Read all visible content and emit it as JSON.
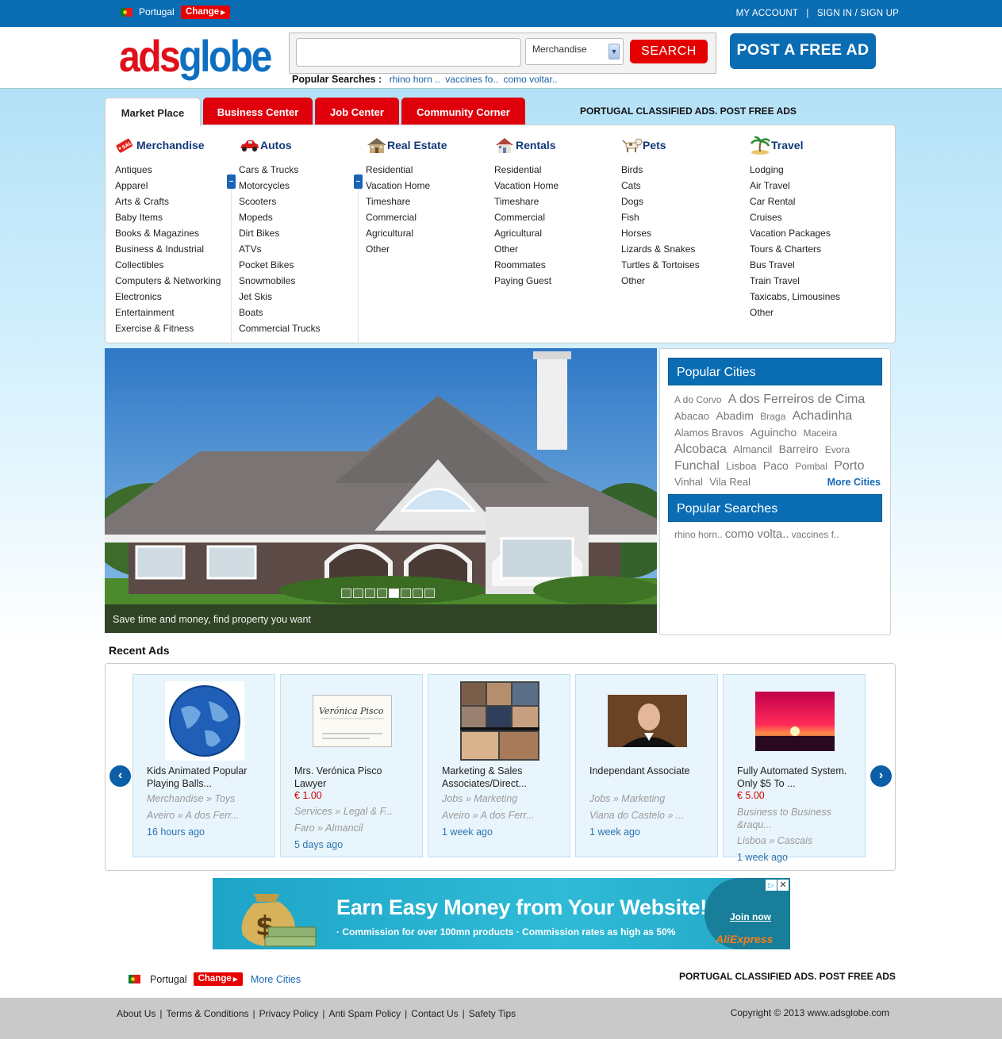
{
  "topbar": {
    "country": "Portugal",
    "change_label": "Change",
    "my_account": "MY ACCOUNT",
    "signin": "SIGN IN / SIGN UP"
  },
  "header": {
    "logo_part1": "ads",
    "logo_part2": "globe",
    "search_placeholder": "",
    "category_selected": "Merchandise",
    "search_button": "SEARCH",
    "popular_label": "Popular Searches :",
    "popular_items": [
      "rhino horn ..",
      "vaccines fo..",
      "como voltar.."
    ],
    "post_ad": "POST A FREE AD"
  },
  "tabs": [
    "Market Place",
    "Business Center",
    "Job Center",
    "Community Corner"
  ],
  "tagline": "PORTUGAL CLASSIFIED ADS. POST FREE ADS",
  "categories": [
    {
      "name": "Merchandise",
      "icon": "sale-tag-icon",
      "items": [
        "Antiques",
        "Apparel",
        "Arts & Crafts",
        "Baby Items",
        "Books & Magazines",
        "Business & Industrial",
        "Collectibles",
        "Computers & Networking",
        "Electronics",
        "Entertainment",
        "Exercise & Fitness"
      ]
    },
    {
      "name": "Autos",
      "icon": "car-icon",
      "items": [
        "Cars & Trucks",
        "Motorcycles",
        "Scooters",
        "Mopeds",
        "Dirt Bikes",
        "ATVs",
        "Pocket Bikes",
        "Snowmobiles",
        "Jet Skis",
        "Boats",
        "Commercial Trucks"
      ]
    },
    {
      "name": "Real Estate",
      "icon": "house-icon",
      "items": [
        "Residential",
        "Vacation Home",
        "Timeshare",
        "Commercial",
        "Agricultural",
        "Other"
      ]
    },
    {
      "name": "Rentals",
      "icon": "rental-house-icon",
      "items": [
        "Residential",
        "Vacation Home",
        "Timeshare",
        "Commercial",
        "Agricultural",
        "Other",
        "Roommates",
        "Paying Guest"
      ]
    },
    {
      "name": "Pets",
      "icon": "dog-icon",
      "items": [
        "Birds",
        "Cats",
        "Dogs",
        "Fish",
        "Horses",
        "Lizards & Snakes",
        "Turtles & Tortoises",
        "Other"
      ]
    },
    {
      "name": "Travel",
      "icon": "palm-island-icon",
      "items": [
        "Lodging",
        "Air Travel",
        "Car Rental",
        "Cruises",
        "Vacation Packages",
        "Tours & Charters",
        "Bus Travel",
        "Train Travel",
        "Taxicabs, Limousines",
        "Other"
      ]
    }
  ],
  "hero": {
    "caption": "Save time and money, find property you want",
    "slide_count": 8,
    "active_slide": 5
  },
  "sidebar": {
    "cities_title": "Popular Cities",
    "cities": [
      {
        "name": "A do Corvo",
        "size": 12
      },
      {
        "name": "A dos Ferreiros de Cima",
        "size": 16
      },
      {
        "name": "Abacao",
        "size": 13
      },
      {
        "name": "Abadim",
        "size": 14
      },
      {
        "name": "Braga",
        "size": 12
      },
      {
        "name": "Achadinha",
        "size": 16
      },
      {
        "name": "Alamos Bravos",
        "size": 13
      },
      {
        "name": "Aguincho",
        "size": 14
      },
      {
        "name": "Maceira",
        "size": 12
      },
      {
        "name": "Alcobaca",
        "size": 16
      },
      {
        "name": "Almancil",
        "size": 13
      },
      {
        "name": "Barreiro",
        "size": 14
      },
      {
        "name": "Evora",
        "size": 12
      },
      {
        "name": "Funchal",
        "size": 16
      },
      {
        "name": "Lisboa",
        "size": 13
      },
      {
        "name": "Paco",
        "size": 14
      },
      {
        "name": "Pombal",
        "size": 12
      },
      {
        "name": "Porto",
        "size": 16
      },
      {
        "name": "Vinhal",
        "size": 13
      },
      {
        "name": "Vila Real",
        "size": 13
      }
    ],
    "more_cities": "More Cities",
    "searches_title": "Popular Searches",
    "searches": [
      {
        "text": "rhino horn..",
        "size": 12
      },
      {
        "text": "como volta..",
        "size": 15
      },
      {
        "text": "vaccines f..",
        "size": 12
      }
    ]
  },
  "recent": {
    "title": "Recent Ads",
    "ads": [
      {
        "thumb": "globe-image",
        "title": "Kids Animated Popular Playing Balls...",
        "price": "",
        "category": "Merchandise » Toys",
        "location": "Aveiro » A dos Ferr...",
        "ago": "16 hours ago"
      },
      {
        "thumb": "business-card-image",
        "title": "Mrs. Verónica Pisco Lawyer",
        "price": "€ 1.00",
        "category": "Services » Legal & F...",
        "location": "Faro » Almancil",
        "ago": "5 days ago"
      },
      {
        "thumb": "photo-collage-image",
        "title": "Marketing & Sales Associates/Direct...",
        "price": "",
        "category": "Jobs » Marketing",
        "location": "Aveiro » A dos Ferr...",
        "ago": "1 week ago"
      },
      {
        "thumb": "portrait-image",
        "title": "Independant Associate",
        "price": "",
        "category": "Jobs » Marketing",
        "location": "Viana do Castelo » ...",
        "ago": "1 week ago"
      },
      {
        "thumb": "sunset-image",
        "title": "Fully Automated System. Only $5 To ...",
        "price": "€ 5.00",
        "category": "Business to Business &raqu...",
        "location": "Lisboa » Cascais",
        "ago": "1 week ago"
      }
    ]
  },
  "banner": {
    "headline": "Earn Easy Money from Your Website!",
    "sub": "· Commission for over 100mn products   · Commission rates as high as 50%",
    "join": "Join now",
    "brand": "AliExpress"
  },
  "footer": {
    "country": "Portugal",
    "change_label": "Change",
    "more_cities": "More Cities",
    "links": [
      "About Us",
      "Terms & Conditions",
      "Privacy Policy",
      "Anti Spam Policy",
      "Contact Us",
      "Safety Tips"
    ],
    "copyright": "Copyright © 2013 www.adsglobe.com"
  },
  "colors": {
    "brand_blue": "#0a6db4",
    "brand_red": "#e0000c"
  }
}
